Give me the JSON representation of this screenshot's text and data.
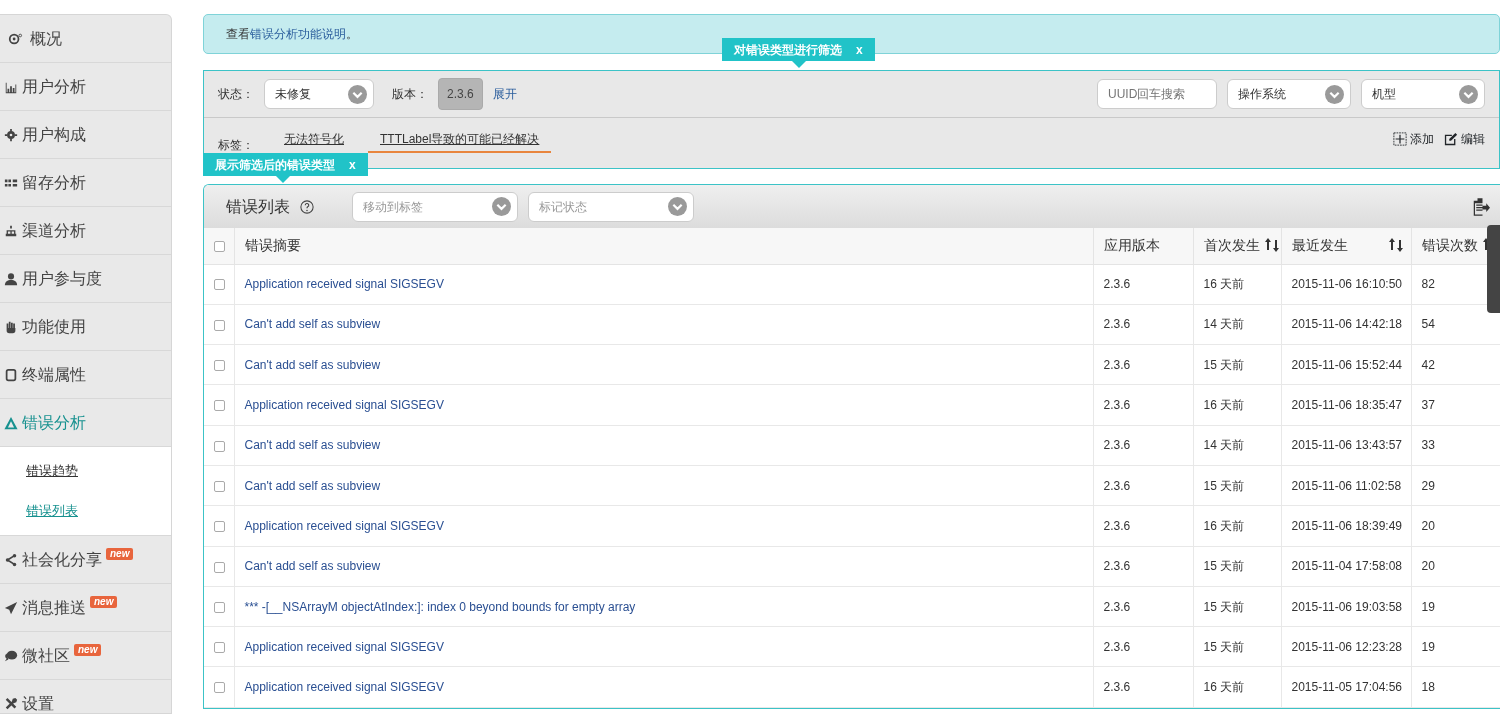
{
  "sidebar": {
    "items": [
      {
        "label": "概况",
        "selected": false
      },
      {
        "label": "用户分析",
        "selected": false
      },
      {
        "label": "用户构成",
        "selected": false
      },
      {
        "label": "留存分析",
        "selected": false
      },
      {
        "label": "渠道分析",
        "selected": false
      },
      {
        "label": "用户参与度",
        "selected": false
      },
      {
        "label": "功能使用",
        "selected": false
      },
      {
        "label": "终端属性",
        "selected": false
      },
      {
        "label": "错误分析",
        "selected": true,
        "expanded": true,
        "children": [
          {
            "label": "错误趋势",
            "selected": false
          },
          {
            "label": "错误列表",
            "selected": true
          }
        ]
      },
      {
        "label": "社会化分享",
        "selected": false,
        "badge": "new"
      },
      {
        "label": "消息推送",
        "selected": false,
        "badge": "new"
      },
      {
        "label": "微社区",
        "selected": false,
        "badge": "new"
      },
      {
        "label": "设置",
        "selected": false
      }
    ]
  },
  "notice": {
    "prefix": "查看",
    "link": "错误分析功能说明",
    "suffix": "。"
  },
  "callouts": [
    {
      "text": "对错误类型进行筛选",
      "close": "x"
    },
    {
      "text": "展示筛选后的错误类型",
      "close": "x"
    }
  ],
  "filters": {
    "status_label": "状态：",
    "status": "未修复",
    "version_label": "版本：",
    "version": "2.3.6",
    "expand_link": "展开",
    "uuid_placeholder": "UUID回车搜索",
    "os": "操作系统",
    "model": "机型",
    "tags_label": "标签：",
    "tags": [
      {
        "label": "无法符号化",
        "selected": false
      },
      {
        "label": "TTTLabel导致的可能已经解决",
        "selected": true
      }
    ],
    "add": "添加",
    "edit": "编辑"
  },
  "error_list": {
    "title": "错误列表",
    "select_all_checked": false,
    "move_placeholder": "移动到标签",
    "mark_placeholder": "标记状态",
    "columns": [
      {
        "label": "错误摘要",
        "sortable": false
      },
      {
        "label": "应用版本",
        "sortable": false
      },
      {
        "label": "首次发生",
        "sortable": true
      },
      {
        "label": "最近发生",
        "sortable": true
      },
      {
        "label": "错误次数",
        "sortable": true
      }
    ],
    "rows": [
      {
        "checked": false,
        "cells": [
          "Application received signal SIGSEGV",
          "2.3.6",
          "16 天前",
          "2015-11-06 16:10:50",
          "82"
        ]
      },
      {
        "checked": false,
        "cells": [
          "Can't add self as subview",
          "2.3.6",
          "14 天前",
          "2015-11-06 14:42:18",
          "54"
        ]
      },
      {
        "checked": false,
        "cells": [
          "Can't add self as subview",
          "2.3.6",
          "15 天前",
          "2015-11-06 15:52:44",
          "42"
        ]
      },
      {
        "checked": false,
        "cells": [
          "Application received signal SIGSEGV",
          "2.3.6",
          "16 天前",
          "2015-11-06 18:35:47",
          "37"
        ]
      },
      {
        "checked": false,
        "cells": [
          "Can't add self as subview",
          "2.3.6",
          "14 天前",
          "2015-11-06 13:43:57",
          "33"
        ]
      },
      {
        "checked": false,
        "cells": [
          "Can't add self as subview",
          "2.3.6",
          "15 天前",
          "2015-11-06 11:02:58",
          "29"
        ]
      },
      {
        "checked": false,
        "cells": [
          "Application received signal SIGSEGV",
          "2.3.6",
          "16 天前",
          "2015-11-06 18:39:49",
          "20"
        ]
      },
      {
        "checked": false,
        "cells": [
          "Can't add self as subview",
          "2.3.6",
          "15 天前",
          "2015-11-04 17:58:08",
          "20"
        ]
      },
      {
        "checked": false,
        "cells": [
          "*** -[__NSArrayM objectAtIndex:]: index 0 beyond bounds for empty array",
          "2.3.6",
          "15 天前",
          "2015-11-06 19:03:58",
          "19"
        ]
      },
      {
        "checked": false,
        "cells": [
          "Application received signal SIGSEGV",
          "2.3.6",
          "15 天前",
          "2015-11-06 12:23:28",
          "19"
        ]
      },
      {
        "checked": false,
        "cells": [
          "Application received signal SIGSEGV",
          "2.3.6",
          "16 天前",
          "2015-11-05 17:04:56",
          "18"
        ]
      }
    ]
  }
}
